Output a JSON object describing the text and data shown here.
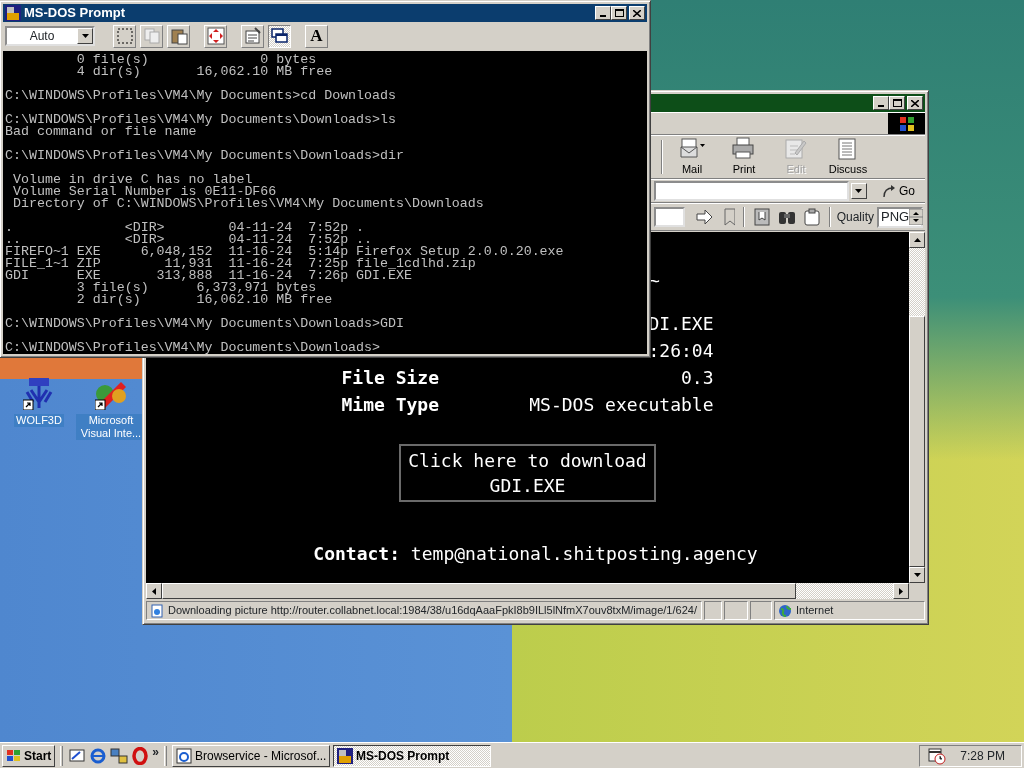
{
  "dos_window": {
    "title": "MS-DOS Prompt",
    "font_size": "Auto",
    "toolbar": [
      {
        "kind": "mark",
        "pressed": false
      },
      {
        "kind": "copy",
        "pressed": false
      },
      {
        "kind": "paste",
        "pressed": false
      },
      {
        "kind": "fullscreen",
        "pressed": false
      },
      {
        "kind": "properties",
        "pressed": false
      },
      {
        "kind": "background",
        "pressed": true
      },
      {
        "kind": "font",
        "pressed": false,
        "label": "A"
      }
    ],
    "console_blocks": [
      [
        "         0 file(s)              0 bytes",
        "         4 dir(s)       16,062.10 MB free"
      ],
      [
        "C:\\WINDOWS\\Profiles\\VM4\\My Documents>cd Downloads"
      ],
      [
        "C:\\WINDOWS\\Profiles\\VM4\\My Documents\\Downloads>ls",
        "Bad command or file name"
      ],
      [
        "C:\\WINDOWS\\Profiles\\VM4\\My Documents\\Downloads>dir"
      ],
      [
        " Volume in drive C has no label",
        " Volume Serial Number is 0E11-DF66",
        " Directory of C:\\WINDOWS\\Profiles\\VM4\\My Documents\\Downloads"
      ],
      [
        ".              <DIR>        04-11-24  7:52p .",
        "..             <DIR>        04-11-24  7:52p ..",
        "FIREFO~1 EXE     6,048,152  11-16-24  5:14p Firefox Setup 2.0.0.20.exe",
        "FILE_1~1 ZIP        11,931  11-16-24  7:25p file_1cdlhd.zip",
        "GDI      EXE       313,888  11-16-24  7:26p GDI.EXE",
        "         3 file(s)      6,373,971 bytes",
        "         2 dir(s)       16,062.10 MB free"
      ],
      [
        "C:\\WINDOWS\\Profiles\\VM4\\My Documents\\Downloads>GDI"
      ],
      [
        "C:\\WINDOWS\\Profiles\\VM4\\My Documents\\Downloads>"
      ]
    ]
  },
  "browser_window": {
    "toolbar_buttons": [
      {
        "kind": "mail",
        "label": "Mail",
        "disabled": false
      },
      {
        "kind": "print",
        "label": "Print",
        "disabled": false
      },
      {
        "kind": "edit",
        "label": "Edit",
        "disabled": true
      },
      {
        "kind": "discuss",
        "label": "Discuss",
        "disabled": false
      }
    ],
    "go_label": "Go",
    "quality_label": "Quality",
    "quality_value": "PNG",
    "page": {
      "heading_fragment": "~",
      "rows": [
        {
          "value": "DI.EXE"
        },
        {
          "value": ":26:04"
        },
        {
          "label": "File Size",
          "value": "0.3"
        },
        {
          "label": "Mime Type",
          "value": "MS-DOS executable"
        }
      ],
      "download_button": "Click here to download GDI.EXE",
      "contact": "**Contact:** temp@national.shitposting.agency"
    },
    "status_text": "Downloading picture http://router.collabnet.local:1984/38/u16dqAaaFpkI8b9ILl5lNfmX7ouv8txM/image/1/624/",
    "zone": "Internet"
  },
  "desktop_icons": [
    {
      "kind": "wolf",
      "label": "WOLF3D"
    },
    {
      "kind": "studio",
      "label": "Microsoft Visual Inte..."
    }
  ],
  "taskbar": {
    "start": "Start",
    "quick_launch_more": "»",
    "tasks": [
      {
        "kind": "browser",
        "label": "Browservice - Microsof...",
        "selected": false
      },
      {
        "kind": "dos",
        "label": "MS-DOS Prompt",
        "selected": true
      }
    ],
    "clock": "7:28 PM"
  }
}
